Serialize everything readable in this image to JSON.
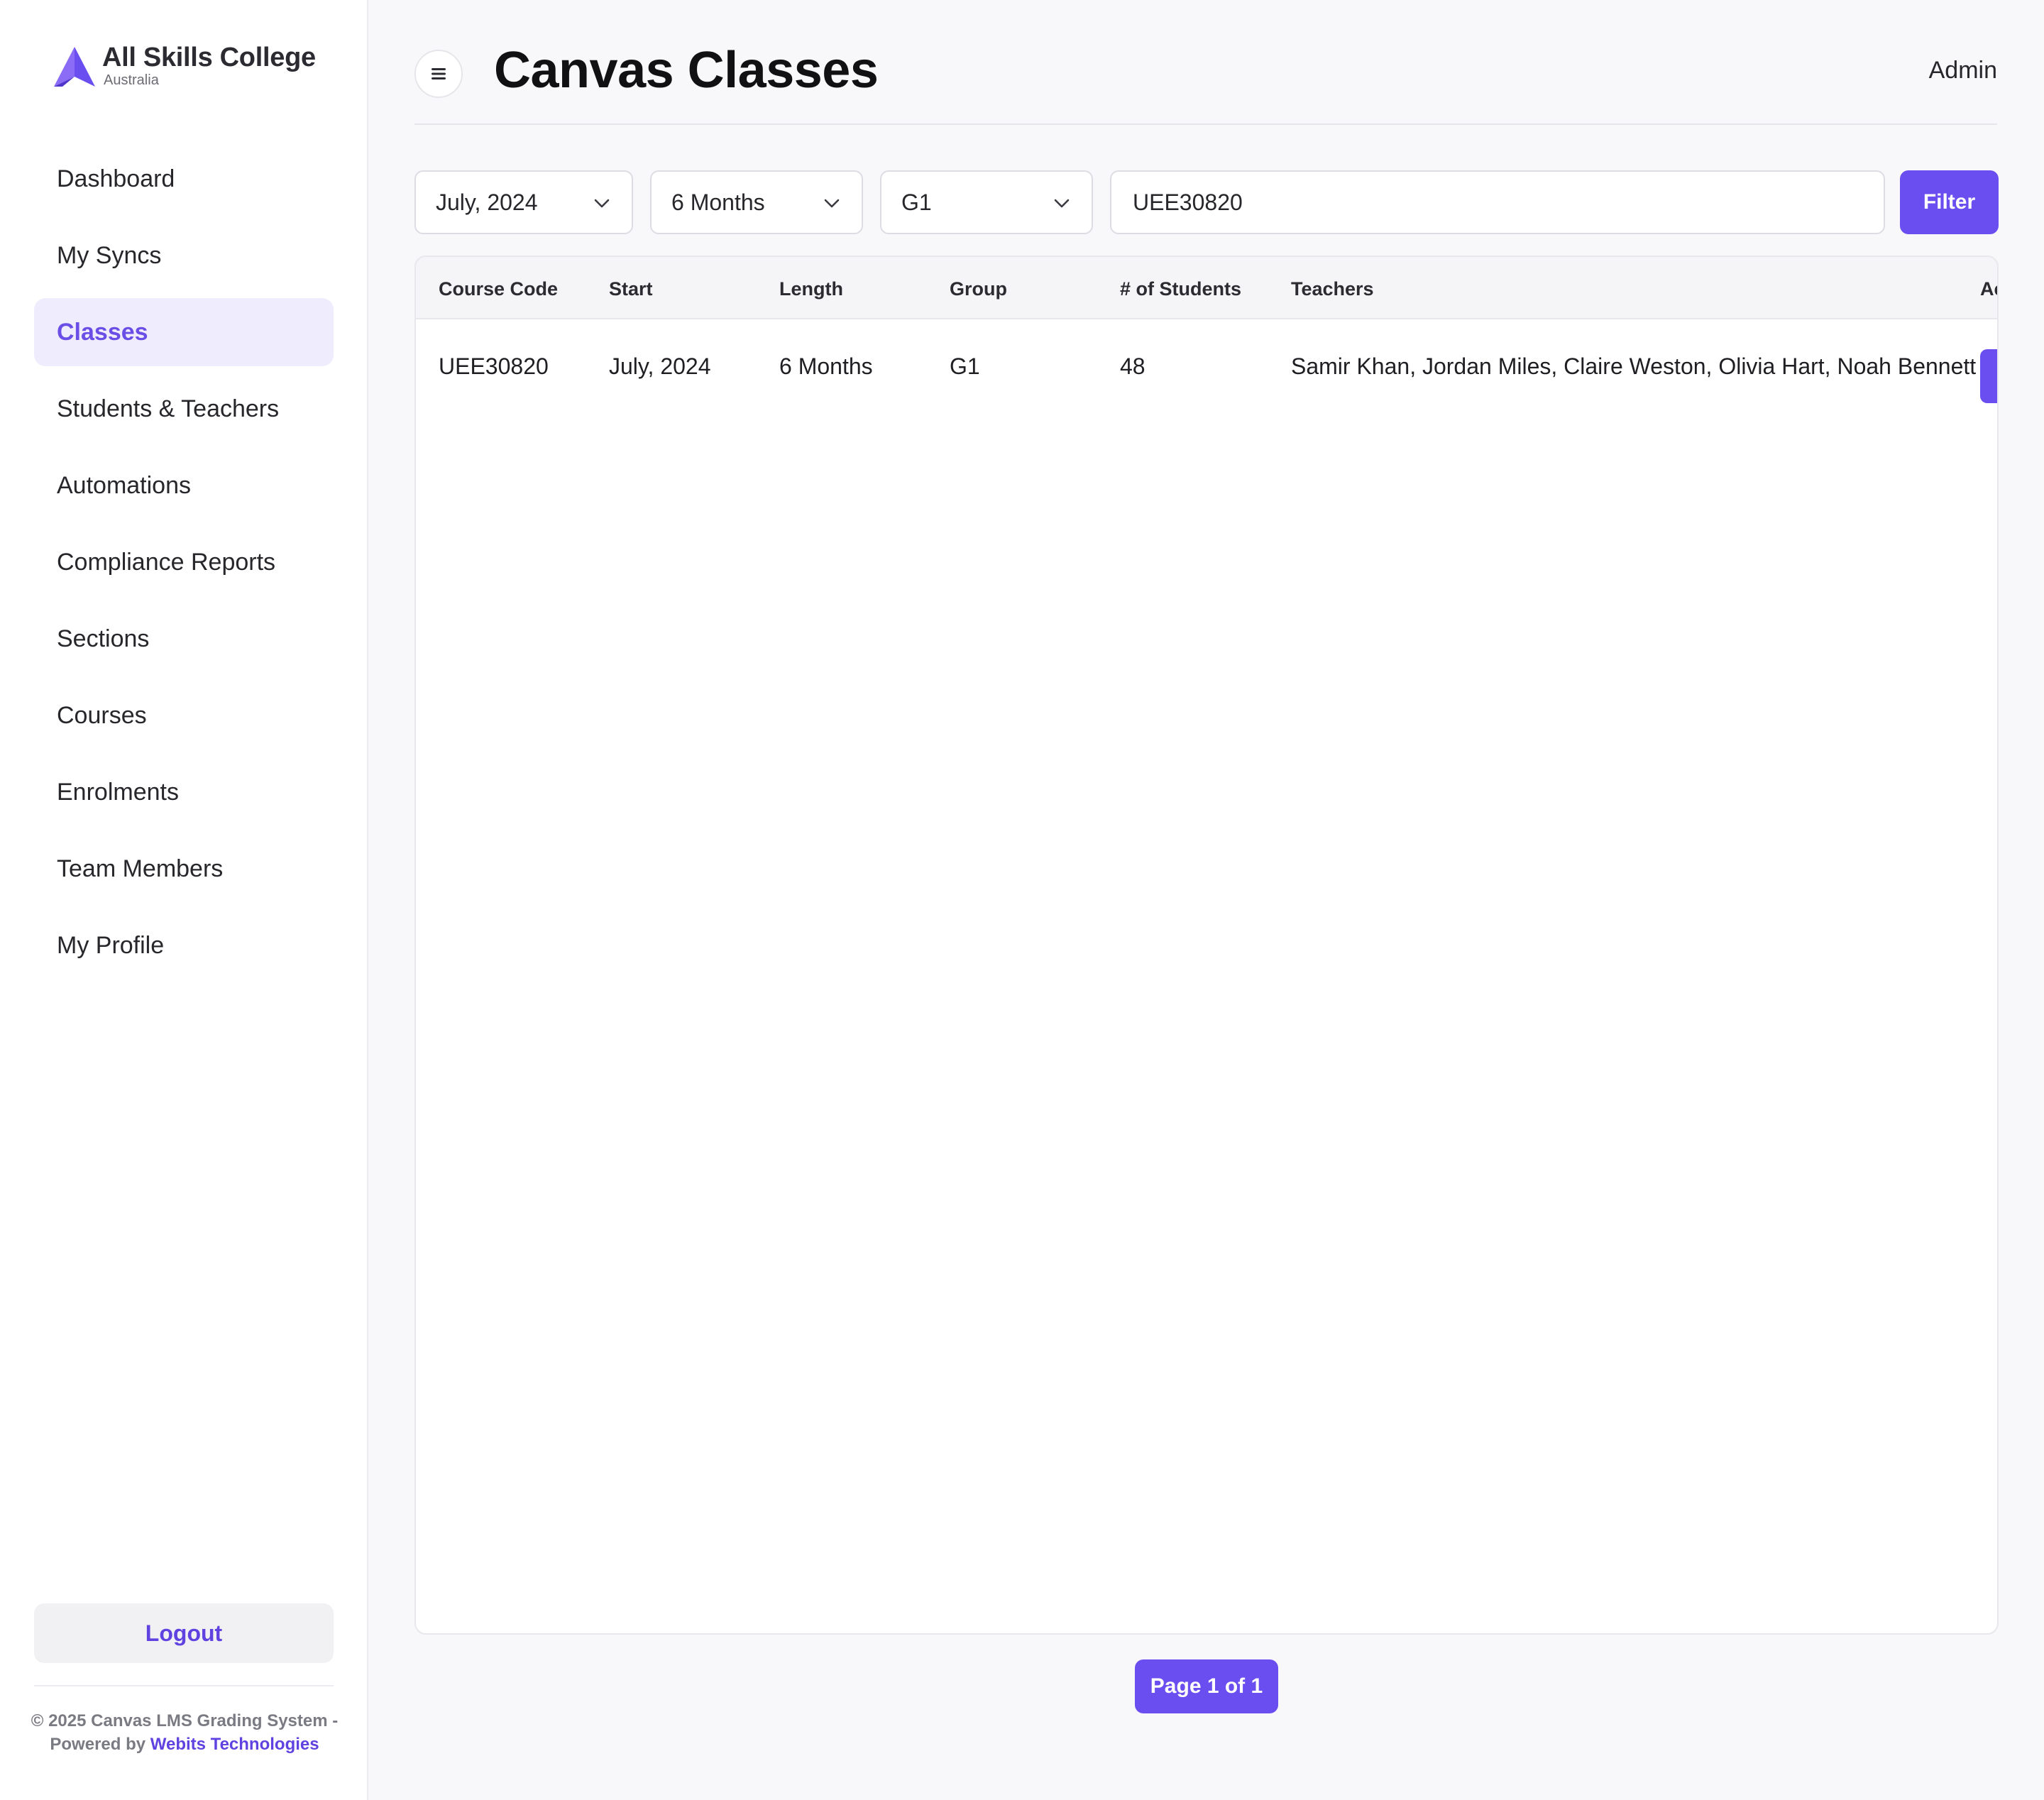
{
  "brand": {
    "name": "All Skills College",
    "subtitle": "Australia"
  },
  "sidebar": {
    "items": [
      {
        "label": "Dashboard",
        "active": false
      },
      {
        "label": "My Syncs",
        "active": false
      },
      {
        "label": "Classes",
        "active": true
      },
      {
        "label": "Students & Teachers",
        "active": false
      },
      {
        "label": "Automations",
        "active": false
      },
      {
        "label": "Compliance Reports",
        "active": false
      },
      {
        "label": "Sections",
        "active": false
      },
      {
        "label": "Courses",
        "active": false
      },
      {
        "label": "Enrolments",
        "active": false
      },
      {
        "label": "Team Members",
        "active": false
      },
      {
        "label": "My Profile",
        "active": false
      }
    ],
    "logout_label": "Logout",
    "footer_text": "© 2025 Canvas LMS Grading System - Powered by",
    "footer_link": "Webits Technologies"
  },
  "header": {
    "title": "Canvas Classes",
    "user": "Admin"
  },
  "filters": {
    "month": "July, 2024",
    "length": "6 Months",
    "group": "G1",
    "search_value": "UEE30820",
    "filter_label": "Filter"
  },
  "table": {
    "headers": [
      "Course Code",
      "Start",
      "Length",
      "Group",
      "# of Students",
      "Teachers",
      "Ac"
    ],
    "rows": [
      {
        "course_code": "UEE30820",
        "start": "July, 2024",
        "length": "6 Months",
        "group": "G1",
        "students": "48",
        "teachers": "Samir Khan, Jordan Miles, Claire Weston, Olivia Hart, Noah Bennett"
      }
    ]
  },
  "pagination": {
    "label": "Page 1 of 1"
  },
  "colors": {
    "accent": "#6b4ef0",
    "active_bg": "#efecfd",
    "background": "#f8f8fa"
  }
}
